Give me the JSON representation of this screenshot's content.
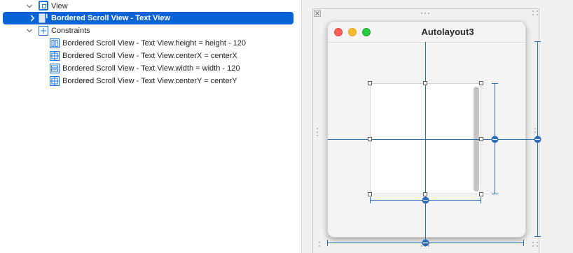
{
  "outline": {
    "items": [
      {
        "label": "View",
        "icon": "view-icon"
      },
      {
        "label": "Bordered Scroll View - Text View",
        "icon": "scroll-view-icon",
        "selected": true
      },
      {
        "label": "Constraints",
        "icon": "constraints-icon"
      },
      {
        "label": "Bordered Scroll View - Text View.height = height - 120",
        "icon": "height-constraint-icon"
      },
      {
        "label": "Bordered Scroll View - Text View.centerX = centerX",
        "icon": "centerx-constraint-icon"
      },
      {
        "label": "Bordered Scroll View - Text View.width = width - 120",
        "icon": "width-constraint-icon"
      },
      {
        "label": "Bordered Scroll View - Text View.centerY = centerY",
        "icon": "centery-constraint-icon"
      }
    ]
  },
  "canvas": {
    "window_title": "Autolayout3"
  },
  "colors": {
    "selection": "#0b63d8",
    "constraint": "#2a6bb8",
    "close": "#fe5f57",
    "minimize": "#febc2e",
    "zoom": "#28c840"
  }
}
